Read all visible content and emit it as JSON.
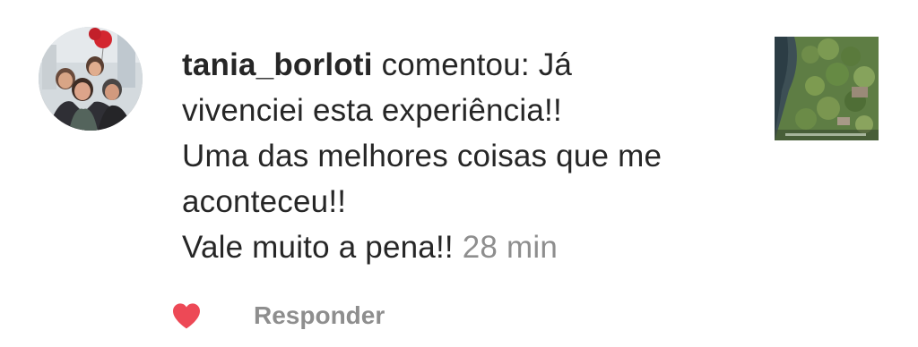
{
  "notification": {
    "username": "tania_borloti",
    "action_text": "comentou: Já",
    "comment_lines": [
      "vivenciei esta experiência!!",
      "Uma das melhores coisas que me",
      "aconteceu!!",
      "Vale muito a pena!!"
    ],
    "timestamp": "28 min",
    "avatar_icon": "profile-photo",
    "thumbnail_icon": "post-thumbnail-aerial-mangrove"
  },
  "actions": {
    "like_icon": "heart-icon",
    "like_color": "#ed4956",
    "reply_label": "Responder"
  },
  "colors": {
    "text": "#262626",
    "secondary": "#8e8e8e"
  }
}
